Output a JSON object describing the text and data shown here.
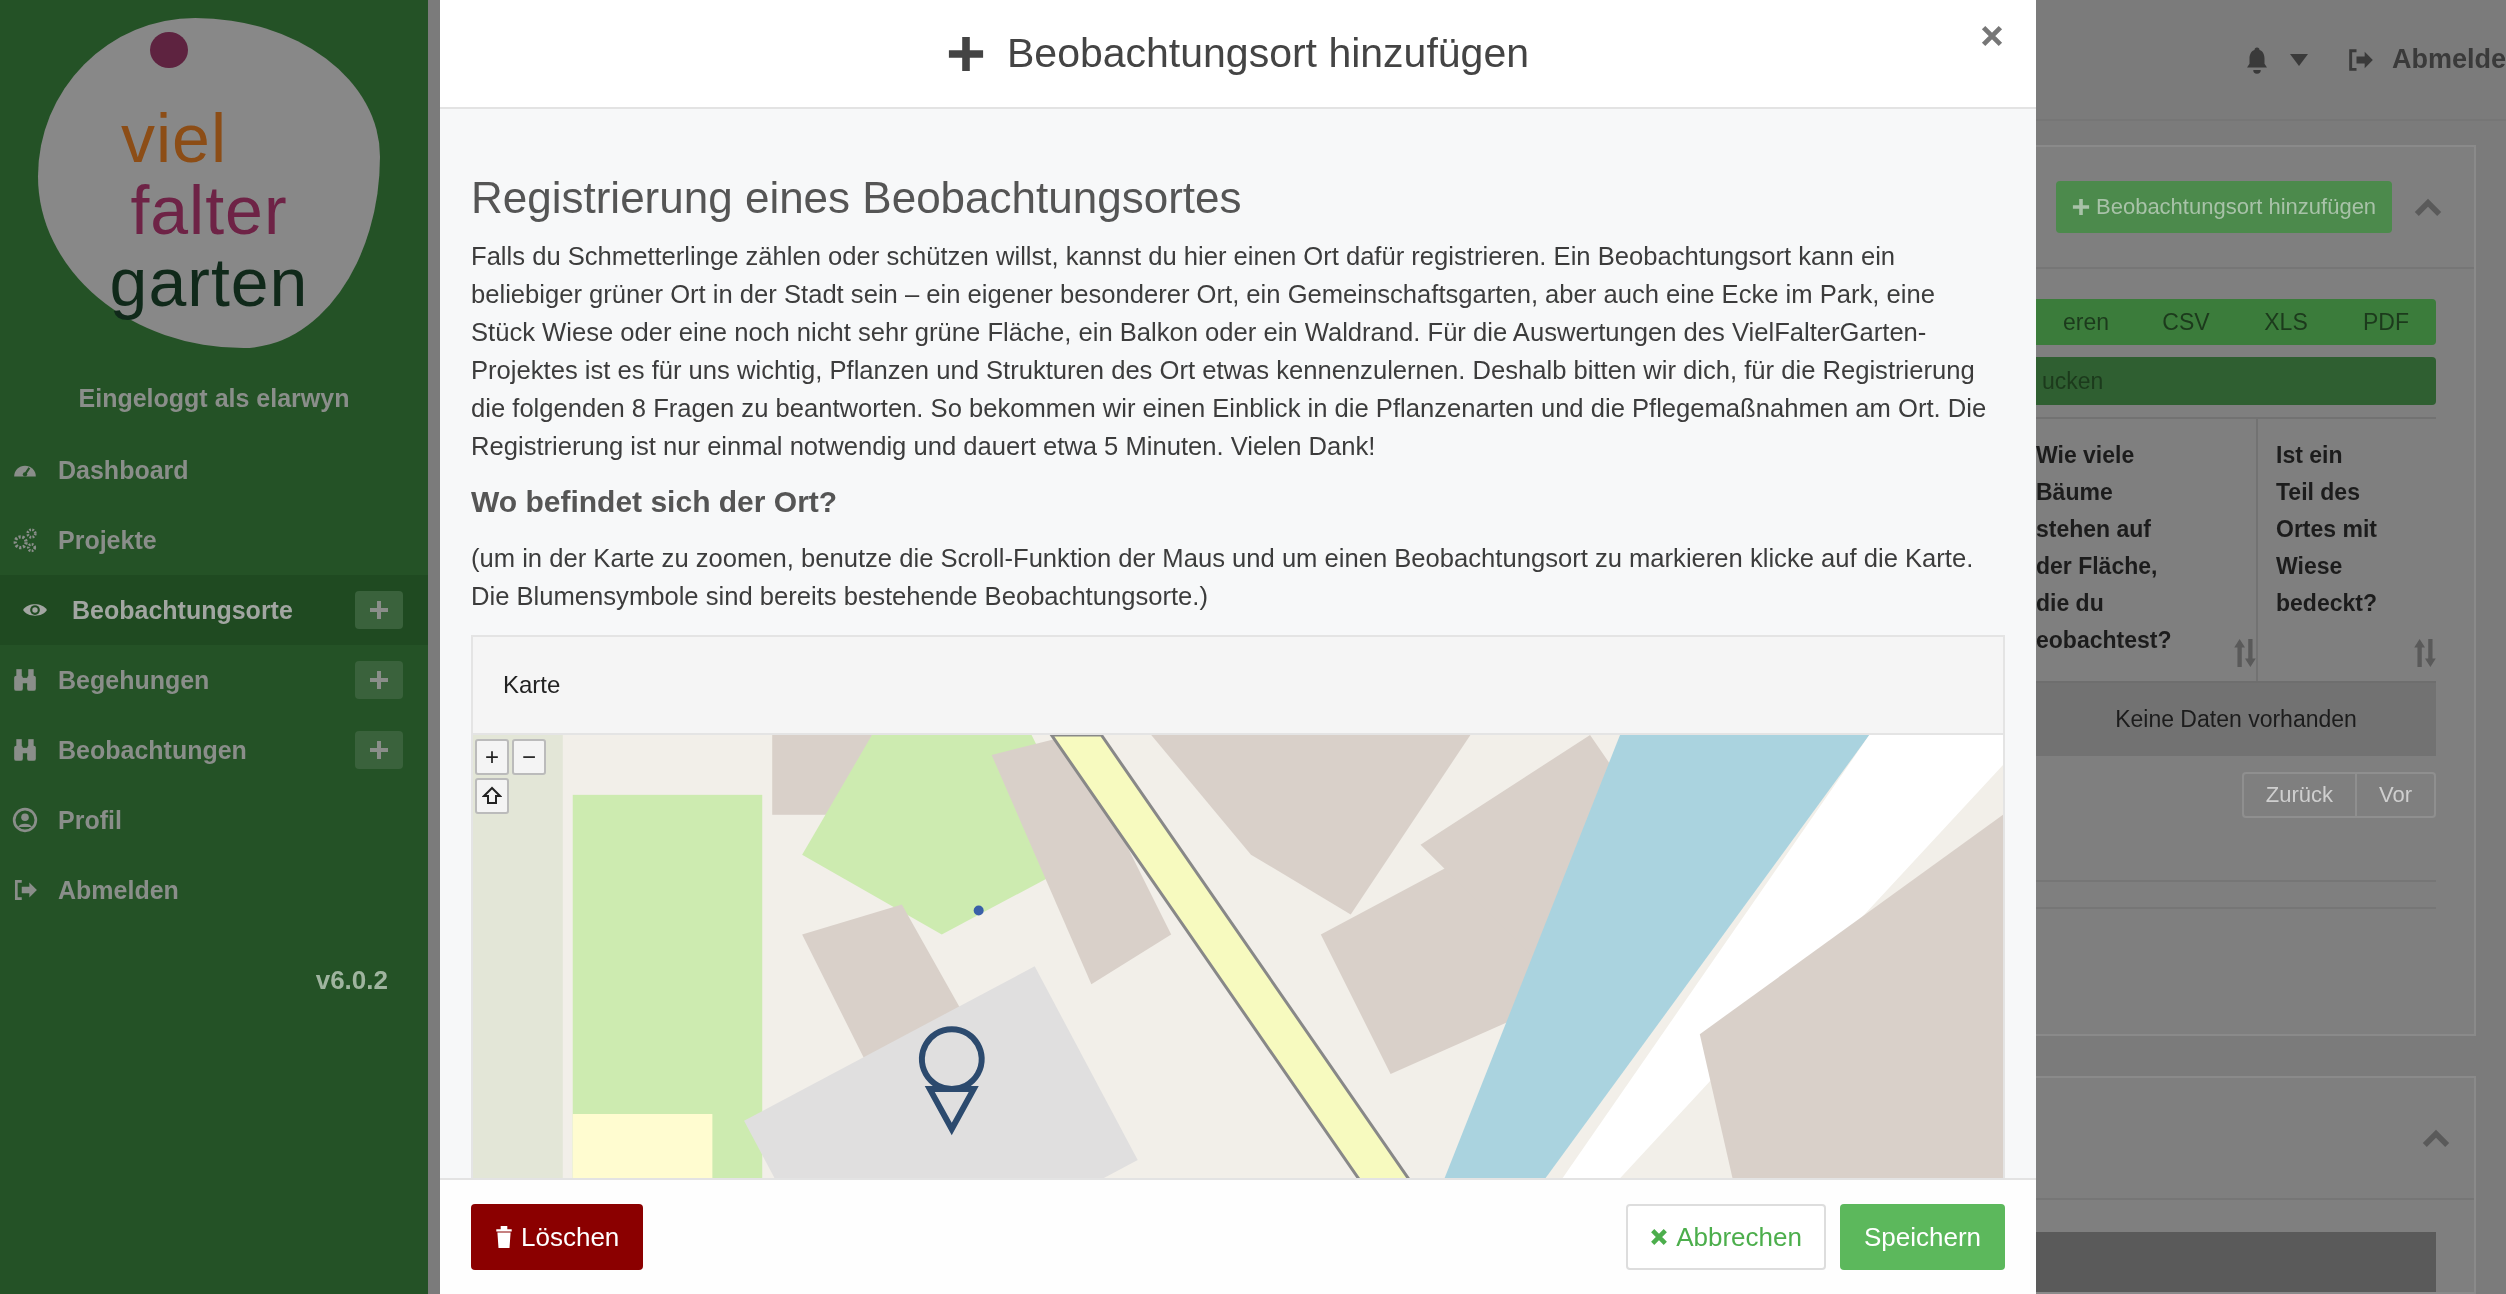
{
  "sidebar": {
    "logo_lines": [
      "viel",
      "falter",
      "garten"
    ],
    "logged_in": "Eingeloggt als elarwyn",
    "items": [
      {
        "label": "Dashboard",
        "kind": "gauge",
        "selected": false,
        "add": false
      },
      {
        "label": "Projekte",
        "kind": "cogs",
        "selected": false,
        "add": false
      },
      {
        "label": "Beobachtungsorte",
        "kind": "eye",
        "selected": true,
        "add": true
      },
      {
        "label": "Begehungen",
        "kind": "binoculars",
        "selected": false,
        "add": true
      },
      {
        "label": "Beobachtungen",
        "kind": "binoculars",
        "selected": false,
        "add": true
      },
      {
        "label": "Profil",
        "kind": "user",
        "selected": false,
        "add": false
      },
      {
        "label": "Abmelden",
        "kind": "signout",
        "selected": false,
        "add": false
      }
    ],
    "version": "v6.0.2"
  },
  "topbar": {
    "logout": "Abmelde"
  },
  "background_panel": {
    "add_button": "Beobachtungsort hinzufügen",
    "export_buttons": [
      "eren",
      "CSV",
      "XLS",
      "PDF"
    ],
    "print_button": "ucken",
    "table": {
      "columns": [
        "Wie viele\nBäume\nstehen auf\nder Fläche,\ndie du\neobachtest?",
        "Ist ein\nTeil des\nOrtes mit\nWiese\nbedeckt?"
      ],
      "empty_message": "Keine Daten vorhanden"
    },
    "pagination": [
      {
        "label": "Zurück",
        "disabled": true
      },
      {
        "label": "Vor",
        "disabled": true
      }
    ]
  },
  "modal": {
    "title": "Beobachtungsort hinzufügen",
    "heading": "Registrierung eines Beobachtungsortes",
    "intro": "Falls du Schmetterlinge zählen oder schützen willst, kannst du hier einen Ort dafür registrieren. Ein Beobachtungsort kann ein beliebiger grüner Ort in der Stadt sein – ein eigener besonderer Ort, ein Gemeinschaftsgarten, aber auch eine Ecke im Park, eine Stück Wiese oder eine noch nicht sehr grüne Fläche, ein Balkon oder ein Waldrand. Für die Auswertungen des VielFalterGarten-Projektes ist es für uns wichtig, Pflanzen und Strukturen des Ort etwas kennenzulernen. Deshalb bitten wir dich, für die Registrierung die folgenden 8 Fragen zu beantworten. So bekommen wir einen Einblick in die Pflanzenarten und die Pflegemaßnahmen am Ort. Die Registrierung ist nur einmal notwendig und dauert etwa 5 Minuten. Vielen Dank!",
    "question": "Wo befindet sich der Ort?",
    "hint": "(um in der Karte zu zoomen, benutze die Scroll-Funktion der Maus und um einen Beobachtungsort zu markieren klicke auf die Karte. Die Blumensymbole sind bereits bestehende Beobachtungsorte.)",
    "map_card": {
      "title": "Karte",
      "zoom_in": "+",
      "zoom_out": "−"
    },
    "buttons": [
      {
        "kind": "delete",
        "label": "Löschen"
      },
      {
        "kind": "cancel",
        "label": "Abbrechen"
      },
      {
        "kind": "save",
        "label": "Speichern"
      }
    ]
  }
}
